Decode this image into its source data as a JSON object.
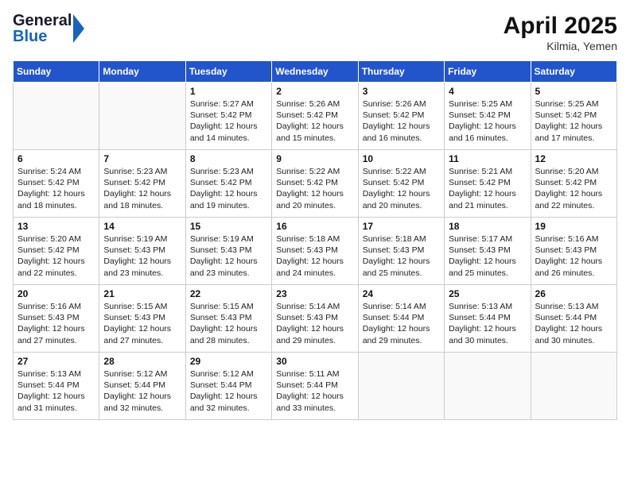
{
  "header": {
    "logo_general": "General",
    "logo_blue": "Blue",
    "month_year": "April 2025",
    "location": "Kilmia, Yemen"
  },
  "weekdays": [
    "Sunday",
    "Monday",
    "Tuesday",
    "Wednesday",
    "Thursday",
    "Friday",
    "Saturday"
  ],
  "weeks": [
    [
      {
        "day": "",
        "sunrise": "",
        "sunset": "",
        "daylight": ""
      },
      {
        "day": "",
        "sunrise": "",
        "sunset": "",
        "daylight": ""
      },
      {
        "day": "1",
        "sunrise": "Sunrise: 5:27 AM",
        "sunset": "Sunset: 5:42 PM",
        "daylight": "Daylight: 12 hours and 14 minutes."
      },
      {
        "day": "2",
        "sunrise": "Sunrise: 5:26 AM",
        "sunset": "Sunset: 5:42 PM",
        "daylight": "Daylight: 12 hours and 15 minutes."
      },
      {
        "day": "3",
        "sunrise": "Sunrise: 5:26 AM",
        "sunset": "Sunset: 5:42 PM",
        "daylight": "Daylight: 12 hours and 16 minutes."
      },
      {
        "day": "4",
        "sunrise": "Sunrise: 5:25 AM",
        "sunset": "Sunset: 5:42 PM",
        "daylight": "Daylight: 12 hours and 16 minutes."
      },
      {
        "day": "5",
        "sunrise": "Sunrise: 5:25 AM",
        "sunset": "Sunset: 5:42 PM",
        "daylight": "Daylight: 12 hours and 17 minutes."
      }
    ],
    [
      {
        "day": "6",
        "sunrise": "Sunrise: 5:24 AM",
        "sunset": "Sunset: 5:42 PM",
        "daylight": "Daylight: 12 hours and 18 minutes."
      },
      {
        "day": "7",
        "sunrise": "Sunrise: 5:23 AM",
        "sunset": "Sunset: 5:42 PM",
        "daylight": "Daylight: 12 hours and 18 minutes."
      },
      {
        "day": "8",
        "sunrise": "Sunrise: 5:23 AM",
        "sunset": "Sunset: 5:42 PM",
        "daylight": "Daylight: 12 hours and 19 minutes."
      },
      {
        "day": "9",
        "sunrise": "Sunrise: 5:22 AM",
        "sunset": "Sunset: 5:42 PM",
        "daylight": "Daylight: 12 hours and 20 minutes."
      },
      {
        "day": "10",
        "sunrise": "Sunrise: 5:22 AM",
        "sunset": "Sunset: 5:42 PM",
        "daylight": "Daylight: 12 hours and 20 minutes."
      },
      {
        "day": "11",
        "sunrise": "Sunrise: 5:21 AM",
        "sunset": "Sunset: 5:42 PM",
        "daylight": "Daylight: 12 hours and 21 minutes."
      },
      {
        "day": "12",
        "sunrise": "Sunrise: 5:20 AM",
        "sunset": "Sunset: 5:42 PM",
        "daylight": "Daylight: 12 hours and 22 minutes."
      }
    ],
    [
      {
        "day": "13",
        "sunrise": "Sunrise: 5:20 AM",
        "sunset": "Sunset: 5:42 PM",
        "daylight": "Daylight: 12 hours and 22 minutes."
      },
      {
        "day": "14",
        "sunrise": "Sunrise: 5:19 AM",
        "sunset": "Sunset: 5:43 PM",
        "daylight": "Daylight: 12 hours and 23 minutes."
      },
      {
        "day": "15",
        "sunrise": "Sunrise: 5:19 AM",
        "sunset": "Sunset: 5:43 PM",
        "daylight": "Daylight: 12 hours and 23 minutes."
      },
      {
        "day": "16",
        "sunrise": "Sunrise: 5:18 AM",
        "sunset": "Sunset: 5:43 PM",
        "daylight": "Daylight: 12 hours and 24 minutes."
      },
      {
        "day": "17",
        "sunrise": "Sunrise: 5:18 AM",
        "sunset": "Sunset: 5:43 PM",
        "daylight": "Daylight: 12 hours and 25 minutes."
      },
      {
        "day": "18",
        "sunrise": "Sunrise: 5:17 AM",
        "sunset": "Sunset: 5:43 PM",
        "daylight": "Daylight: 12 hours and 25 minutes."
      },
      {
        "day": "19",
        "sunrise": "Sunrise: 5:16 AM",
        "sunset": "Sunset: 5:43 PM",
        "daylight": "Daylight: 12 hours and 26 minutes."
      }
    ],
    [
      {
        "day": "20",
        "sunrise": "Sunrise: 5:16 AM",
        "sunset": "Sunset: 5:43 PM",
        "daylight": "Daylight: 12 hours and 27 minutes."
      },
      {
        "day": "21",
        "sunrise": "Sunrise: 5:15 AM",
        "sunset": "Sunset: 5:43 PM",
        "daylight": "Daylight: 12 hours and 27 minutes."
      },
      {
        "day": "22",
        "sunrise": "Sunrise: 5:15 AM",
        "sunset": "Sunset: 5:43 PM",
        "daylight": "Daylight: 12 hours and 28 minutes."
      },
      {
        "day": "23",
        "sunrise": "Sunrise: 5:14 AM",
        "sunset": "Sunset: 5:43 PM",
        "daylight": "Daylight: 12 hours and 29 minutes."
      },
      {
        "day": "24",
        "sunrise": "Sunrise: 5:14 AM",
        "sunset": "Sunset: 5:44 PM",
        "daylight": "Daylight: 12 hours and 29 minutes."
      },
      {
        "day": "25",
        "sunrise": "Sunrise: 5:13 AM",
        "sunset": "Sunset: 5:44 PM",
        "daylight": "Daylight: 12 hours and 30 minutes."
      },
      {
        "day": "26",
        "sunrise": "Sunrise: 5:13 AM",
        "sunset": "Sunset: 5:44 PM",
        "daylight": "Daylight: 12 hours and 30 minutes."
      }
    ],
    [
      {
        "day": "27",
        "sunrise": "Sunrise: 5:13 AM",
        "sunset": "Sunset: 5:44 PM",
        "daylight": "Daylight: 12 hours and 31 minutes."
      },
      {
        "day": "28",
        "sunrise": "Sunrise: 5:12 AM",
        "sunset": "Sunset: 5:44 PM",
        "daylight": "Daylight: 12 hours and 32 minutes."
      },
      {
        "day": "29",
        "sunrise": "Sunrise: 5:12 AM",
        "sunset": "Sunset: 5:44 PM",
        "daylight": "Daylight: 12 hours and 32 minutes."
      },
      {
        "day": "30",
        "sunrise": "Sunrise: 5:11 AM",
        "sunset": "Sunset: 5:44 PM",
        "daylight": "Daylight: 12 hours and 33 minutes."
      },
      {
        "day": "",
        "sunrise": "",
        "sunset": "",
        "daylight": ""
      },
      {
        "day": "",
        "sunrise": "",
        "sunset": "",
        "daylight": ""
      },
      {
        "day": "",
        "sunrise": "",
        "sunset": "",
        "daylight": ""
      }
    ]
  ]
}
